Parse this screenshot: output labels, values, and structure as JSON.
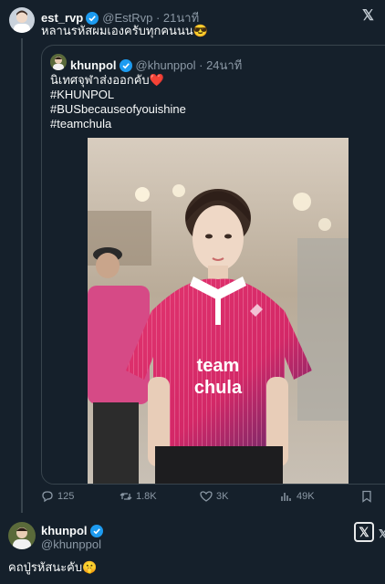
{
  "tweet": {
    "author_name": "est_rvp",
    "author_handle": "@EstRvp",
    "time": "21นาที",
    "text": "หลานรหัสผมเองครับทุกคนนน😎"
  },
  "quoted": {
    "author_name": "khunpol",
    "author_handle": "@khunppol",
    "time": "24นาที",
    "lines": [
      "นิเทศจุฬาส่งออกคับ❤️",
      "#KHUNPOL",
      "#BUSbecauseofyouishine",
      "#teamchula"
    ],
    "shirt_text": [
      "team",
      "chula"
    ]
  },
  "actions": {
    "replies": "125",
    "reposts": "1.8K",
    "likes": "3K",
    "views": "49K"
  },
  "reply": {
    "author_name": "khunpol",
    "author_handle": "@khunppol",
    "text": "คถปู่รหัสนะคับ🤫"
  },
  "icons": {
    "x_logo": "x-logo-icon",
    "verified": "verified-badge-icon"
  },
  "colors": {
    "background": "#15202b",
    "verified": "#1d9bf0",
    "muted": "#8b98a5",
    "shirt": "#e0306e"
  }
}
